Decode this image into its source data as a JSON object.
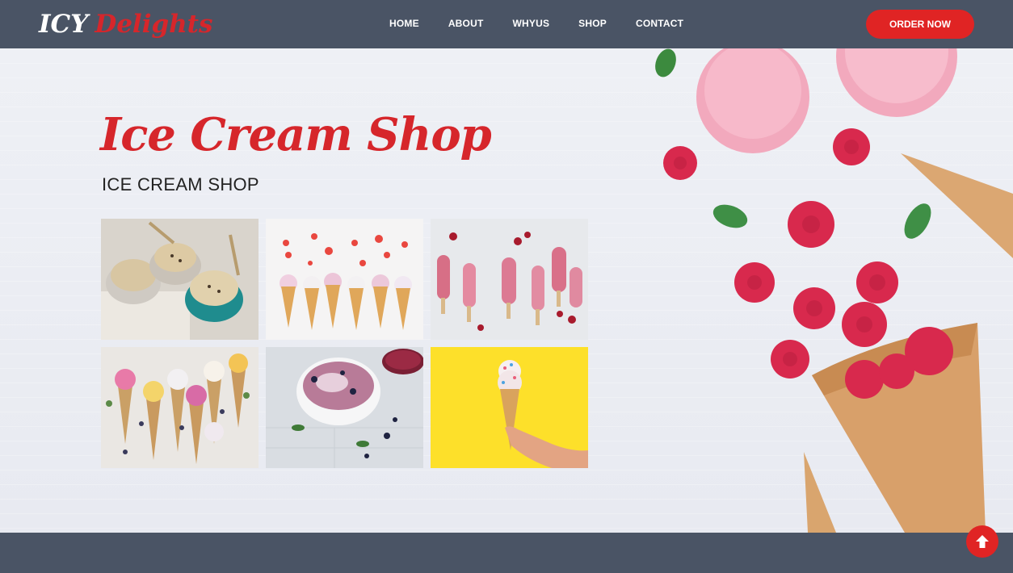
{
  "brand": {
    "part1": "ICY",
    "part2": "Delights"
  },
  "nav": {
    "items": [
      {
        "label": "HOME"
      },
      {
        "label": "ABOUT"
      },
      {
        "label": "WHYUS"
      },
      {
        "label": "SHOP"
      },
      {
        "label": "CONTACT"
      }
    ],
    "cta_label": "ORDER NOW"
  },
  "hero": {
    "title": "Ice Cream Shop",
    "subtitle": "ICE CREAM SHOP"
  },
  "gallery": {
    "items": [
      {
        "icon": "ice-cream-bowls-image"
      },
      {
        "icon": "strawberry-cones-image"
      },
      {
        "icon": "popsicles-image"
      },
      {
        "icon": "flower-cones-image"
      },
      {
        "icon": "blueberry-bowl-image"
      },
      {
        "icon": "hand-cone-image"
      }
    ]
  },
  "colors": {
    "accent": "#e02424",
    "navbar": "#4a5465",
    "title": "#d6262b",
    "background": "#e9ebf1"
  },
  "back_to_top": {
    "icon": "arrow-up-icon"
  }
}
